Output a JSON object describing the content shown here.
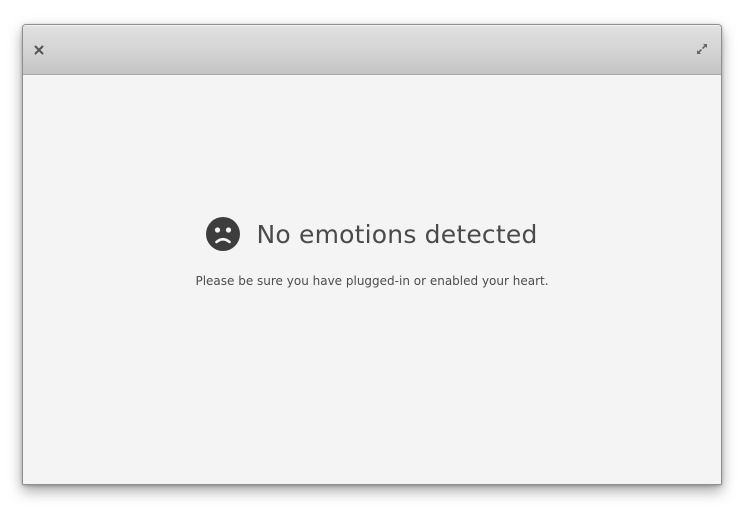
{
  "window": {
    "close_icon": "close-icon",
    "maximize_icon": "maximize-icon"
  },
  "message": {
    "icon": "sad-face-icon",
    "title": "No emotions detected",
    "subtitle": "Please be sure you have plugged-in or enabled your heart."
  },
  "colors": {
    "content_background": "#f4f4f4",
    "titlebar_top": "#e1e1e1",
    "titlebar_bottom": "#c4c4c4",
    "icon": "#3d3d3d",
    "title_text": "#4a4a4a"
  }
}
